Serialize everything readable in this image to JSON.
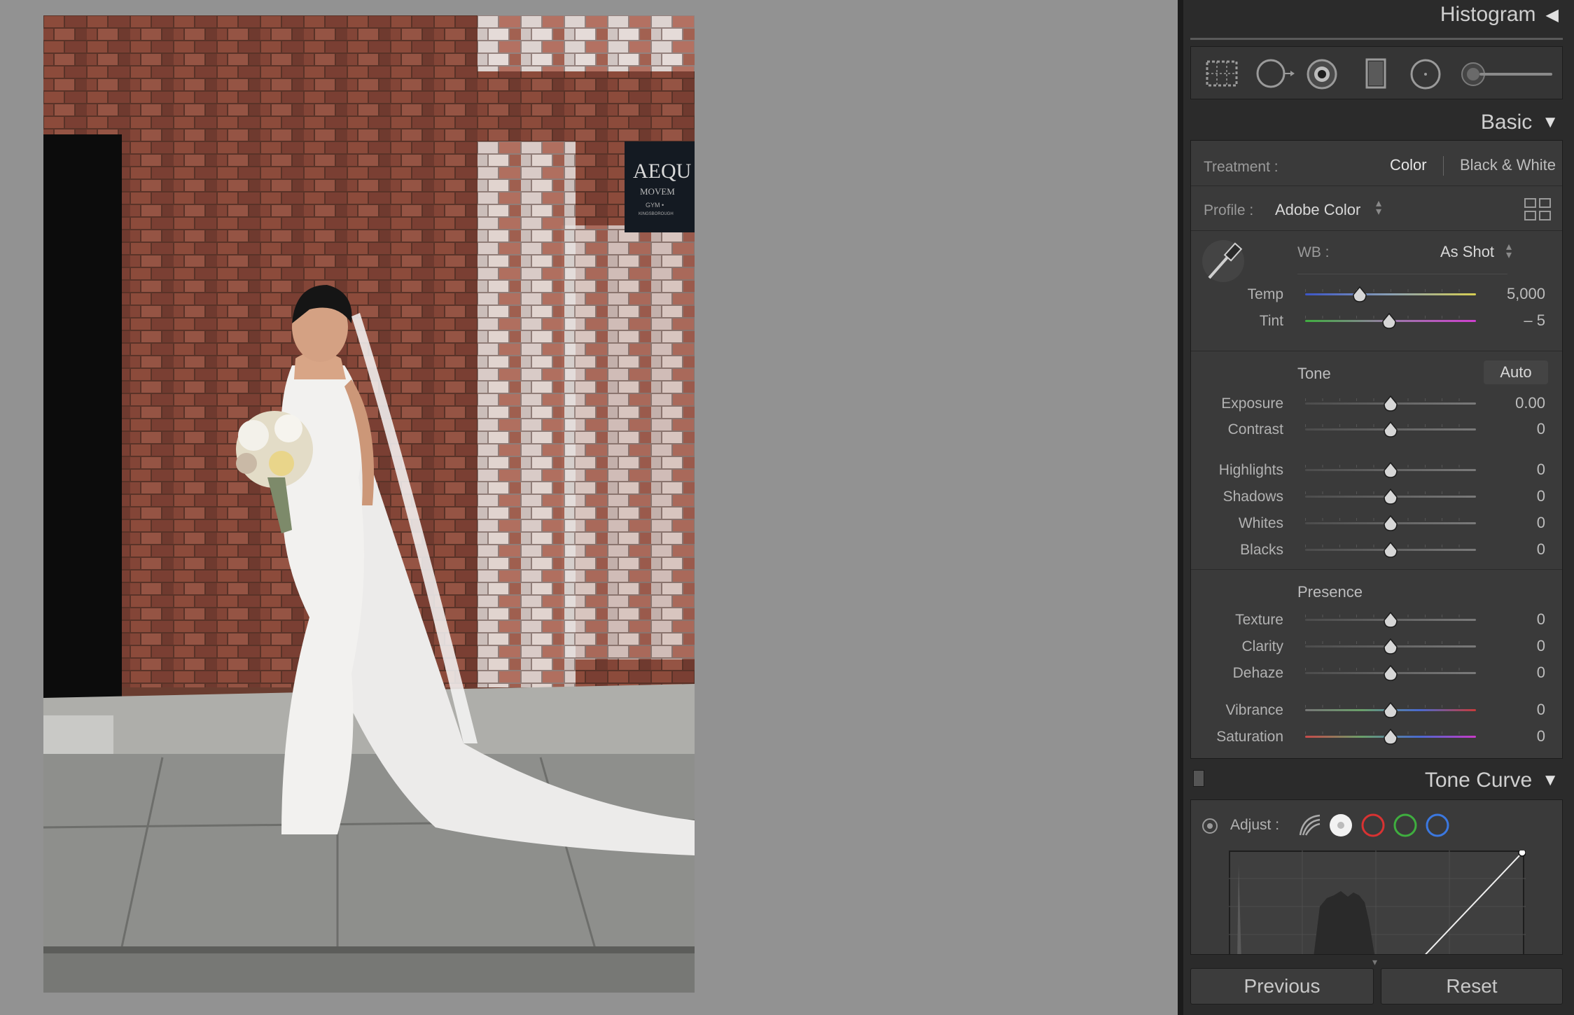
{
  "panels": {
    "histogram": "Histogram",
    "basic": "Basic",
    "tone_curve": "Tone Curve"
  },
  "treatment": {
    "label": "Treatment :",
    "color": "Color",
    "bw": "Black & White"
  },
  "profile": {
    "label": "Profile :",
    "value": "Adobe Color"
  },
  "wb": {
    "label": "WB :",
    "value": "As Shot"
  },
  "sliders": {
    "temp": {
      "label": "Temp",
      "value": "5,000",
      "pos": 0.32
    },
    "tint": {
      "label": "Tint",
      "value": "– 5",
      "pos": 0.49
    },
    "exposure": {
      "label": "Exposure",
      "value": "0.00",
      "pos": 0.5
    },
    "contrast": {
      "label": "Contrast",
      "value": "0",
      "pos": 0.5
    },
    "highlights": {
      "label": "Highlights",
      "value": "0",
      "pos": 0.5
    },
    "shadows": {
      "label": "Shadows",
      "value": "0",
      "pos": 0.5
    },
    "whites": {
      "label": "Whites",
      "value": "0",
      "pos": 0.5
    },
    "blacks": {
      "label": "Blacks",
      "value": "0",
      "pos": 0.5
    },
    "texture": {
      "label": "Texture",
      "value": "0",
      "pos": 0.5
    },
    "clarity": {
      "label": "Clarity",
      "value": "0",
      "pos": 0.5
    },
    "dehaze": {
      "label": "Dehaze",
      "value": "0",
      "pos": 0.5
    },
    "vibrance": {
      "label": "Vibrance",
      "value": "0",
      "pos": 0.5
    },
    "saturation": {
      "label": "Saturation",
      "value": "0",
      "pos": 0.5
    }
  },
  "tone": {
    "label": "Tone",
    "auto": "Auto"
  },
  "presence": {
    "label": "Presence"
  },
  "curve": {
    "adjust": "Adjust :"
  },
  "photo_sign": {
    "line1": "AEQU",
    "line2": "MOVEM",
    "line3": "GYM •",
    "line4": "KINGSBOROUGH"
  },
  "buttons": {
    "previous": "Previous",
    "reset": "Reset"
  }
}
